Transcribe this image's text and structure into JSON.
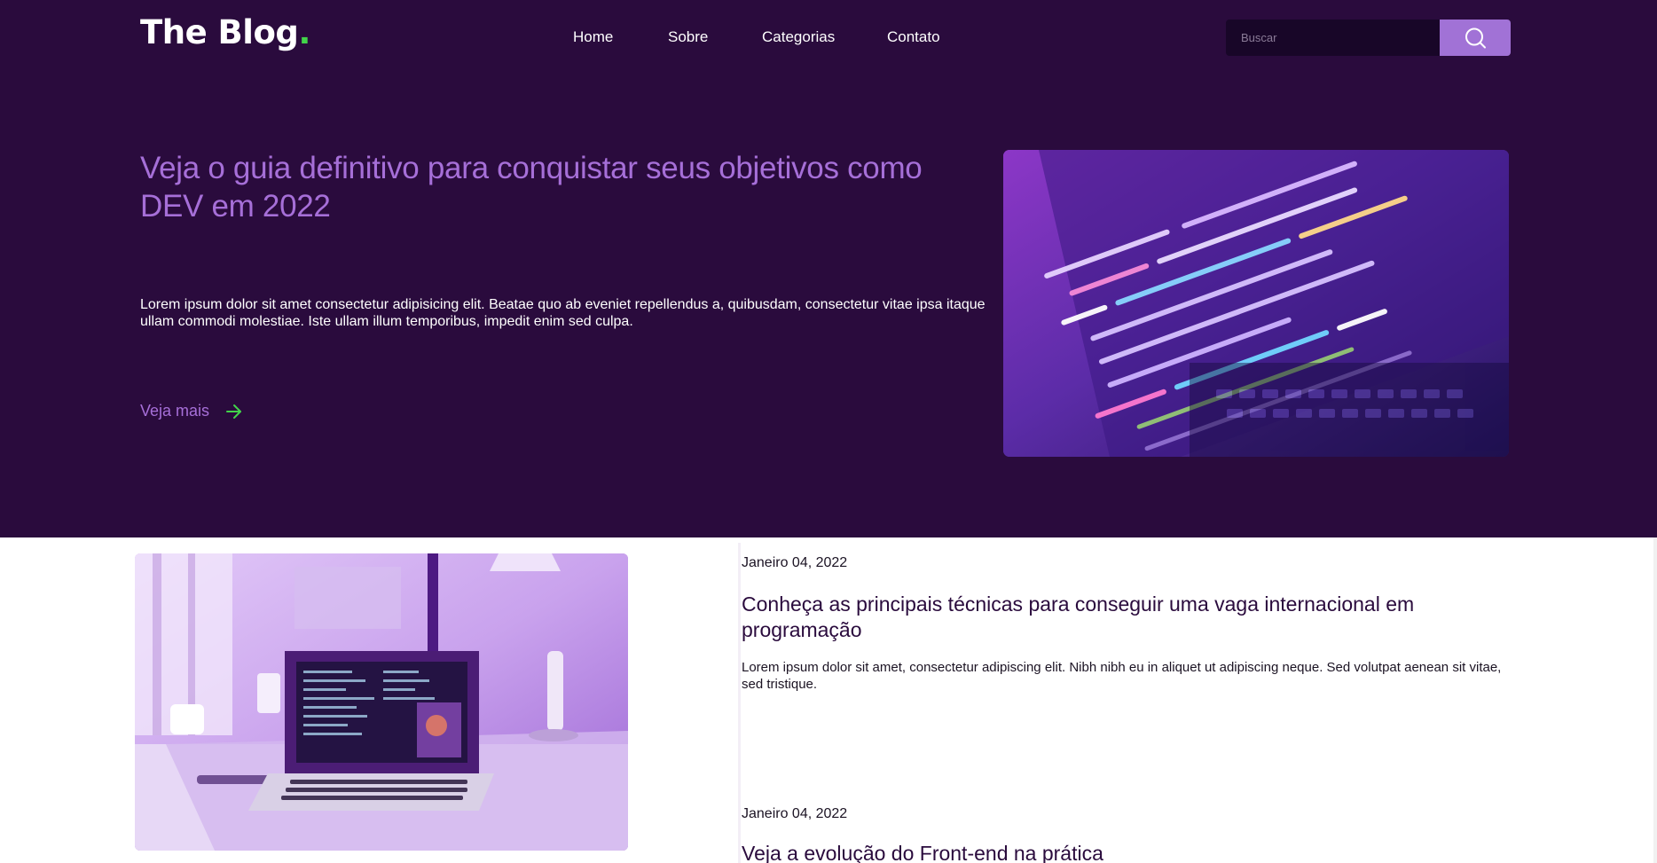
{
  "header": {
    "logo": "The Blog",
    "logo_dot": ".",
    "nav": [
      {
        "label": "Home"
      },
      {
        "label": "Sobre"
      },
      {
        "label": "Categorias"
      },
      {
        "label": "Contato"
      }
    ],
    "search_placeholder": "Buscar"
  },
  "hero": {
    "title": "Veja o guia definitivo para conquistar seus objetivos como DEV em 2022",
    "text": "Lorem ipsum dolor sit amet consectetur adipisicing elit. Beatae quo ab eveniet repellendus a, quibusdam, consectetur vitae ipsa itaque ullam commodi molestiae. Iste ullam illum temporibus, impedit enim sed culpa.",
    "link_label": "Veja mais"
  },
  "posts": [
    {
      "date": "Janeiro 04, 2022",
      "title": "Conheça as principais técnicas para conseguir uma vaga internacional em programação",
      "text": "Lorem ipsum dolor sit amet, consectetur adipiscing elit. Nibh nibh eu in aliquet ut adipiscing neque. Sed volutpat aenean sit vitae, sed tristique."
    },
    {
      "date": "Janeiro 04, 2022",
      "title": "Veja a evolução do Front-end na prática"
    }
  ],
  "colors": {
    "hero_background": "#2a0b3d",
    "accent_purple": "#a66fd8",
    "search_button": "#a172d6",
    "logo_dot": "#42d44a",
    "arrow_green": "#42d44a"
  },
  "icons": {
    "search": "search-icon",
    "arrow": "arrow-right-icon"
  }
}
